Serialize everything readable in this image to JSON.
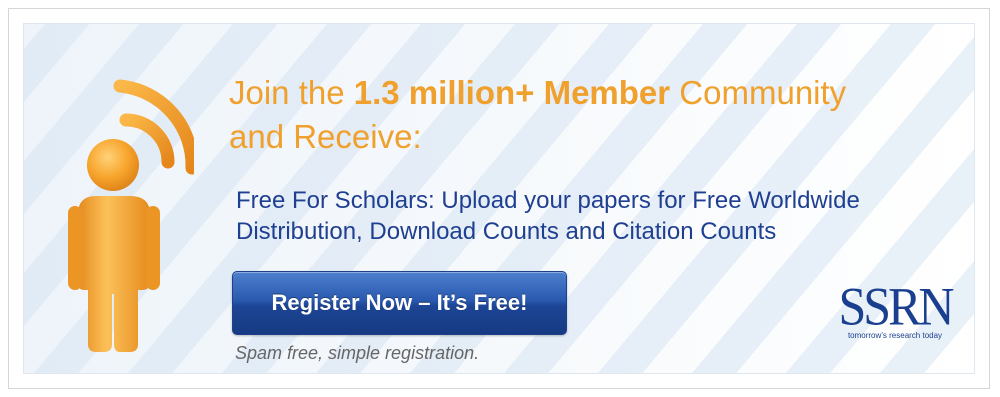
{
  "banner": {
    "headline_prefix": "Join the",
    "headline_highlight": "1.3 million+ Member",
    "headline_suffix": "Community",
    "headline_line2": "and Receive:",
    "subtext_line1": "Free For Scholars: Upload your papers for Free Worldwide",
    "subtext_line2": "Distribution, Download Counts and Citation Counts",
    "register_button_label": "Register Now – It’s Free!",
    "spam_note": "Spam free, simple registration."
  },
  "logo": {
    "wordmark": "SSRN",
    "tagline": "tomorrow’s research today"
  },
  "colors": {
    "headline": "#f0a02c",
    "subtext": "#1f3f91",
    "button": "#2a5ab0",
    "logo": "#1b3f8f",
    "icon_orange": "#f4a028"
  },
  "icons": {
    "person": "person-broadcasting-icon"
  }
}
